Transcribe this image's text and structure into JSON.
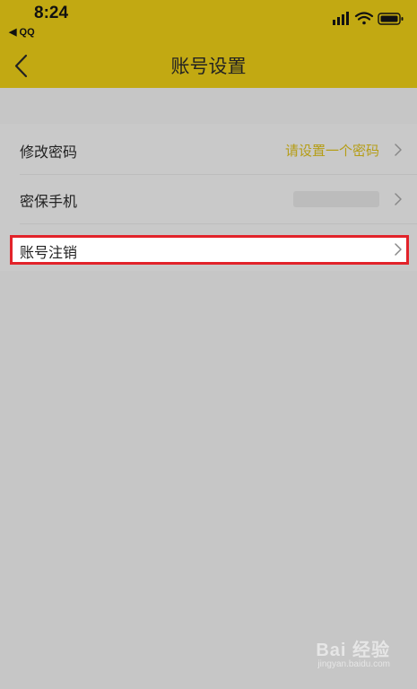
{
  "status_bar": {
    "time": "8:24",
    "back_app": "◀ QQ",
    "icons": [
      "signal-icon",
      "wifi-icon",
      "battery-icon"
    ]
  },
  "nav": {
    "title": "账号设置",
    "back_icon": "chevron-left-icon"
  },
  "settings": {
    "change_password": {
      "label": "修改密码",
      "value": "请设置一个密码"
    },
    "security_phone": {
      "label": "密保手机",
      "value": ""
    },
    "account_cancel": {
      "label": "账号注销"
    }
  },
  "watermark": {
    "main": "Bai 经验",
    "sub": "jingyan.baidu.com"
  },
  "colors": {
    "header": "#c2a912",
    "accent_value": "#b59d16",
    "highlight_border": "#e2232a"
  }
}
